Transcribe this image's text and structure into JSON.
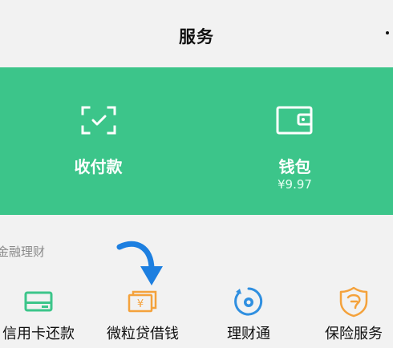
{
  "header": {
    "title": "服务",
    "more_icon": "more-dots-icon"
  },
  "banner": {
    "color": "#3cc58a",
    "items": [
      {
        "label": "收付款",
        "icon": "scan-qr-icon"
      },
      {
        "label": "钱包",
        "icon": "wallet-icon",
        "sub": "¥9.97"
      }
    ]
  },
  "finance": {
    "title": "金融理财",
    "items": [
      {
        "label": "信用卡还款",
        "icon": "credit-card-icon",
        "color": "#3cc58a"
      },
      {
        "label": "微粒贷借钱",
        "icon": "loan-icon",
        "color": "#f4a23c"
      },
      {
        "label": "理财通",
        "icon": "wealth-icon",
        "color": "#2f8fe0"
      },
      {
        "label": "保险服务",
        "icon": "insurance-icon",
        "color": "#f4a23c"
      }
    ]
  },
  "annotation": {
    "arrow_color": "#1d7fe0",
    "icon": "pointer-arrow-icon"
  }
}
